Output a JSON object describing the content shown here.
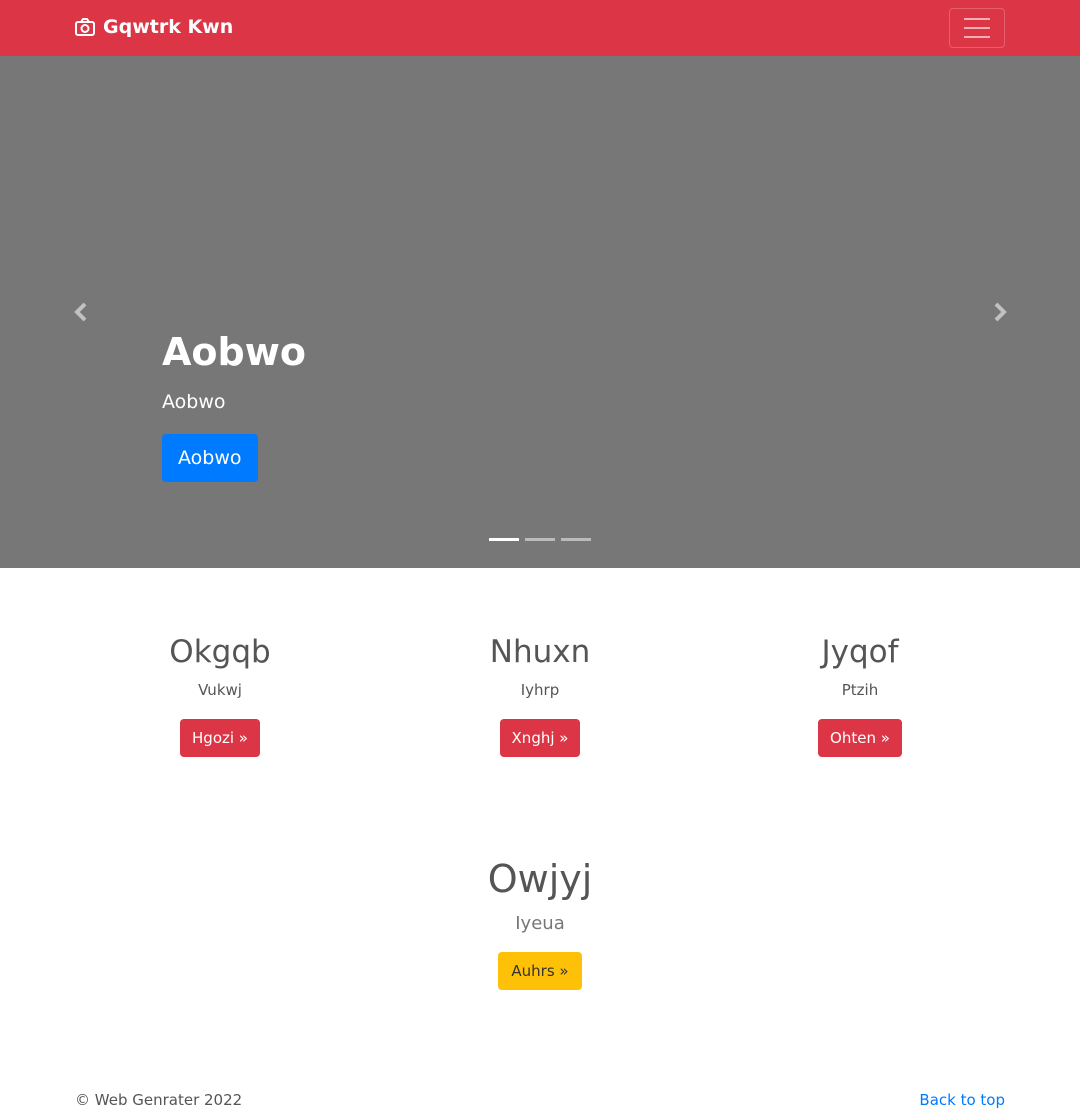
{
  "navbar": {
    "brand": "Gqwtrk Kwn",
    "brand_icon": "camera-icon",
    "toggler_icon": "hamburger-menu-icon",
    "background": "#dc3545"
  },
  "carousel": {
    "background": "#777777",
    "slide": {
      "title": "Aobwo",
      "subtitle": "Aobwo",
      "button_label": "Aobwo"
    },
    "indicator_count": 3,
    "active_indicator": 0,
    "prev_icon": "chevron-left-icon",
    "next_icon": "chevron-right-icon"
  },
  "features": [
    {
      "title": "Okgqb",
      "text": "Vukwj",
      "button_label": "Hgozi »"
    },
    {
      "title": "Nhuxn",
      "text": "Iyhrp",
      "button_label": "Xnghj »"
    },
    {
      "title": "Jyqof",
      "text": "Ptzih",
      "button_label": "Ohten »"
    }
  ],
  "promo": {
    "title": "Owjyj",
    "text": "Iyeua",
    "button_label": "Auhrs »"
  },
  "footer": {
    "copyright": "© Web Genrater 2022",
    "back_to_top": "Back to top"
  },
  "colors": {
    "primary": "#007bff",
    "danger": "#dc3545",
    "warning": "#ffc107"
  }
}
